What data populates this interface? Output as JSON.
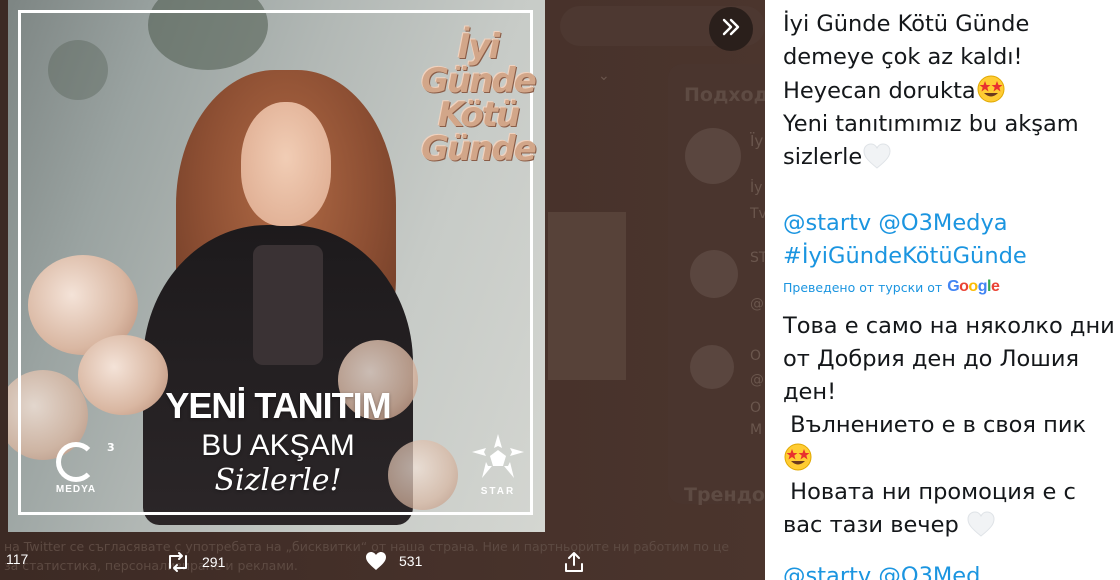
{
  "background": {
    "next_label": "Next image",
    "ghost_heading_1": "Подход",
    "ghost_heading_2": "Трендо",
    "ghost_lines": [
      "Ïy",
      "İy",
      "Tv",
      "ST",
      "@",
      "O",
      "@",
      "O",
      "M"
    ],
    "cookie_line_1": "на Twitter се съгласявате с употребата на „бисквитки“ от наша страна. Ние и партньорите ни работим по це",
    "cookie_line_2": "за статистика, персонализиране и реклами."
  },
  "image": {
    "show_logo": [
      "İyi",
      "Günde",
      "Kötü",
      "Günde"
    ],
    "banner_line_1": "YENİ TANITIM",
    "banner_line_2": "BU AKŞAM",
    "banner_line_3": "Sizlerle!",
    "medya_label": "MEDYA",
    "medya_sup": "3",
    "star_label": "STAR"
  },
  "actions": {
    "replies": "117",
    "retweets": "291",
    "likes": "531"
  },
  "tweet": {
    "lines": [
      "İyi Günde Kötü Günde",
      "demeye çok az kaldı!",
      "Heyecan dorukta",
      "Yeni tanıtımımız bu akşam",
      "sizlerle"
    ],
    "mention_1": "@startv",
    "mention_2": "@O3Medya",
    "hashtag": "#İyiGündeKötüGünde",
    "translated_from": "Преведено от турски от",
    "google": "Google",
    "translation_lines": [
      "Това е само на няколко дни",
      "от Добрия ден до Лошия",
      "ден!",
      " Вълнението е в своя пик",
      " Новата ни промоция е с",
      "вас тази вечер"
    ],
    "repeat_mentions": "@startv @O3Med"
  },
  "colors": {
    "link": "#1b95e0",
    "text": "#14171a",
    "overlay": "#3e2b25"
  }
}
